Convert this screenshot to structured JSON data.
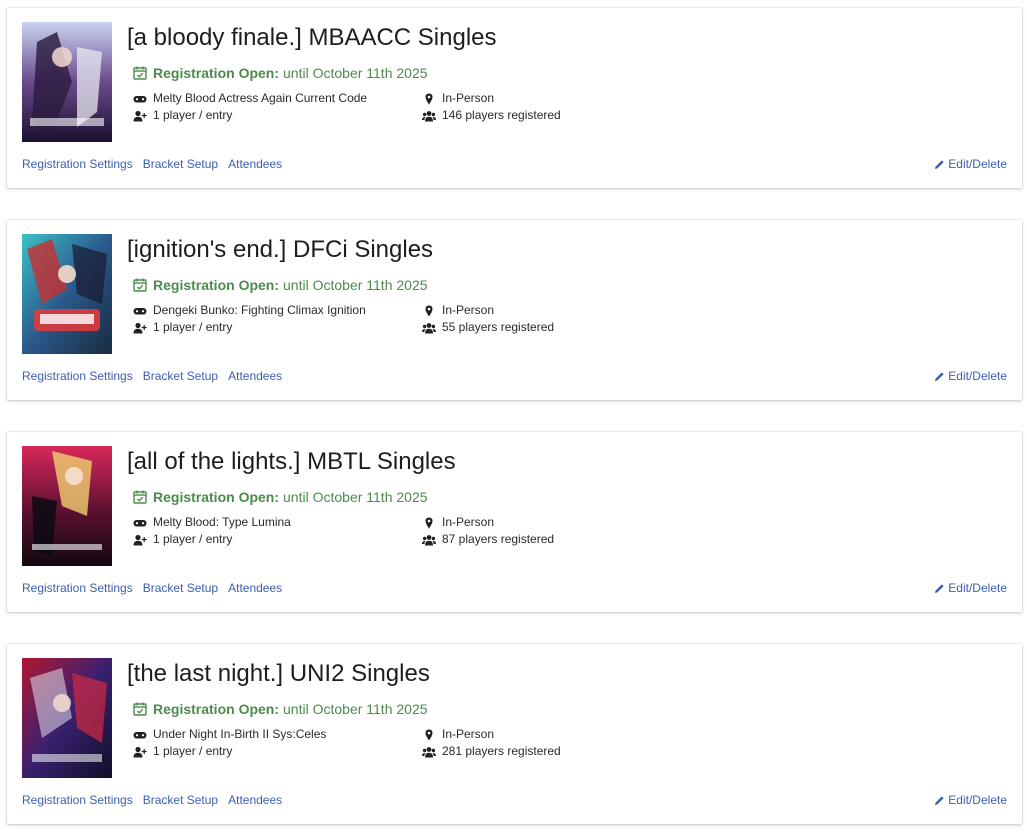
{
  "status_label": "Registration Open:",
  "links": {
    "registration_settings": "Registration Settings",
    "bracket_setup": "Bracket Setup",
    "attendees": "Attendees",
    "edit_delete": "Edit/Delete"
  },
  "icons": {
    "calendar": "calendar-check-icon",
    "game": "gamepad-icon",
    "format": "user-plus-icon",
    "location": "map-marker-icon",
    "players": "users-icon",
    "edit": "pencil-icon"
  },
  "colors": {
    "status_green": "#4d8b4d",
    "link_blue": "#3c5fae"
  },
  "events": [
    {
      "title": "[a bloody finale.] MBAACC Singles",
      "deadline": "until October 11th 2025",
      "game": "Melty Blood Actress Again Current Code",
      "format": "1 player / entry",
      "location": "In-Person",
      "registered": "146 players registered"
    },
    {
      "title": "[ignition's end.] DFCi Singles",
      "deadline": "until October 11th 2025",
      "game": "Dengeki Bunko: Fighting Climax Ignition",
      "format": "1 player / entry",
      "location": "In-Person",
      "registered": "55 players registered"
    },
    {
      "title": "[all of the lights.] MBTL Singles",
      "deadline": "until October 11th 2025",
      "game": "Melty Blood: Type Lumina",
      "format": "1 player / entry",
      "location": "In-Person",
      "registered": "87 players registered"
    },
    {
      "title": "[the last night.] UNI2 Singles",
      "deadline": "until October 11th 2025",
      "game": "Under Night In-Birth II Sys:Celes",
      "format": "1 player / entry",
      "location": "In-Person",
      "registered": "281 players registered"
    }
  ]
}
